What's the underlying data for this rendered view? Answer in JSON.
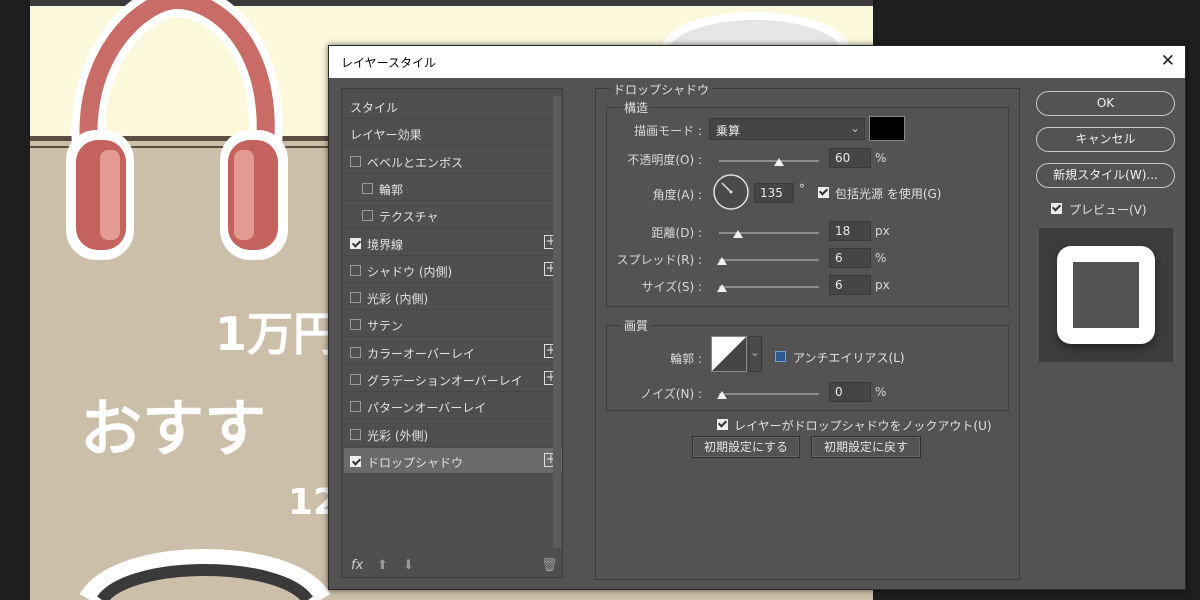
{
  "canvas": {
    "line1": "1万円",
    "line2": "おすす",
    "line3": "12"
  },
  "dialog": {
    "title": "レイヤースタイル",
    "close": "✕"
  },
  "style_list": [
    {
      "label": "スタイル",
      "checkbox": false,
      "checked": false,
      "plus": false,
      "indent": 0
    },
    {
      "label": "レイヤー効果",
      "checkbox": false,
      "checked": false,
      "plus": false,
      "indent": 0
    },
    {
      "label": "ベベルとエンボス",
      "checkbox": true,
      "checked": false,
      "plus": false,
      "indent": 0
    },
    {
      "label": "輪郭",
      "checkbox": true,
      "checked": false,
      "plus": false,
      "indent": 1
    },
    {
      "label": "テクスチャ",
      "checkbox": true,
      "checked": false,
      "plus": false,
      "indent": 1
    },
    {
      "label": "境界線",
      "checkbox": true,
      "checked": true,
      "plus": true,
      "indent": 0
    },
    {
      "label": "シャドウ (内側)",
      "checkbox": true,
      "checked": false,
      "plus": true,
      "indent": 0
    },
    {
      "label": "光彩 (内側)",
      "checkbox": true,
      "checked": false,
      "plus": false,
      "indent": 0
    },
    {
      "label": "サテン",
      "checkbox": true,
      "checked": false,
      "plus": false,
      "indent": 0
    },
    {
      "label": "カラーオーバーレイ",
      "checkbox": true,
      "checked": false,
      "plus": true,
      "indent": 0
    },
    {
      "label": "グラデーションオーバーレイ",
      "checkbox": true,
      "checked": false,
      "plus": true,
      "indent": 0
    },
    {
      "label": "パターンオーバーレイ",
      "checkbox": true,
      "checked": false,
      "plus": false,
      "indent": 0
    },
    {
      "label": "光彩 (外側)",
      "checkbox": true,
      "checked": false,
      "plus": false,
      "indent": 0
    },
    {
      "label": "ドロップシャドウ",
      "checkbox": true,
      "checked": true,
      "plus": true,
      "indent": 0,
      "selected": true
    }
  ],
  "footer_icons": {
    "fx": "fx",
    "up": "⬆",
    "down": "⬇",
    "trash": "🗑"
  },
  "drop_shadow": {
    "section_title": "ドロップシャドウ",
    "structure_title": "構造",
    "blend_mode_label": "描画モード :",
    "blend_mode_value": "乗算",
    "shadow_color": "#000000",
    "opacity_label": "不透明度(O) :",
    "opacity_value": "60",
    "opacity_unit": "%",
    "opacity_level": 0.6,
    "angle_label": "角度(A) :",
    "angle_value": "135",
    "angle_unit": "°",
    "global_light_label": "包括光源 を使用(G)",
    "global_light_checked": true,
    "distance_label": "距離(D) :",
    "distance_value": "18",
    "distance_unit": "px",
    "spread_label": "スプレッド(R) :",
    "spread_value": "6",
    "spread_unit": "%",
    "size_label": "サイズ(S) :",
    "size_value": "6",
    "size_unit": "px",
    "quality_title": "画質",
    "contour_label": "輪郭 :",
    "antialias_label": "アンチエイリアス(L)",
    "antialias_checked": false,
    "noise_label": "ノイズ(N) :",
    "noise_value": "0",
    "noise_unit": "%",
    "knockout_label": "レイヤーがドロップシャドウをノックアウト(U)",
    "knockout_checked": true,
    "reset_default_button": "初期設定にする",
    "restore_default_button": "初期設定に戻す"
  },
  "actions": {
    "ok": "OK",
    "cancel": "キャンセル",
    "new_style": "新規スタイル(W)...",
    "preview_label": "プレビュー(V)",
    "preview_checked": true
  },
  "colors": {
    "dialog_bg": "#535353",
    "canvas_beige": "#cbbfa9",
    "canvas_cream": "#fbf8dc",
    "headphone": "#d4736b"
  }
}
